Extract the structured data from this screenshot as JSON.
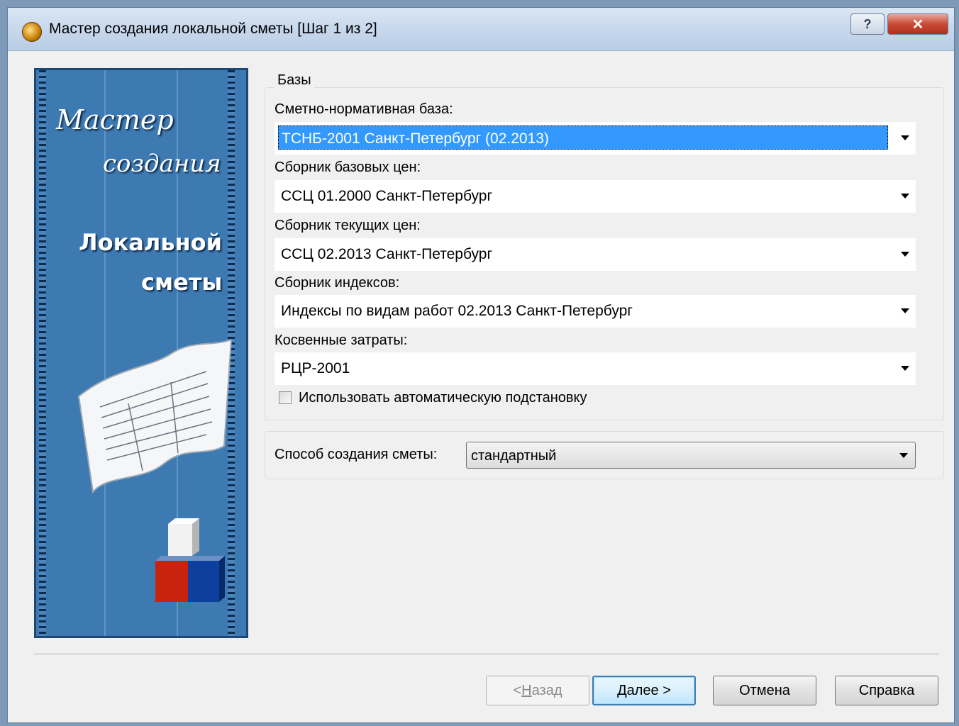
{
  "window": {
    "title": "Мастер создания локальной сметы [Шаг 1 из 2]",
    "help_label": "?",
    "close_label": "✕"
  },
  "banner": {
    "line1": "Мастер",
    "line2": "создания",
    "line3": "Локальной",
    "line4": "сметы"
  },
  "bases": {
    "legend": "Базы",
    "normative_label": "Сметно-нормативная база:",
    "normative_value": "ТСНБ-2001 Санкт-Петербург (02.2013)",
    "base_prices_label": "Сборник базовых цен:",
    "base_prices_value": "ССЦ 01.2000 Санкт-Петербург",
    "current_prices_label": "Сборник текущих цен:",
    "current_prices_value": "ССЦ 02.2013 Санкт-Петербург",
    "indexes_label": "Сборник индексов:",
    "indexes_value": "Индексы по видам работ 02.2013 Санкт-Петербург",
    "indirect_label": "Косвенные затраты:",
    "indirect_value": "РЦР-2001",
    "auto_checkbox_label": "Использовать автоматическую подстановку",
    "auto_checked": false
  },
  "method": {
    "label": "Способ создания сметы:",
    "value": "стандартный"
  },
  "buttons": {
    "back_prefix": "< ",
    "back_accel": "Н",
    "back_rest": "азад",
    "next_accel": "Д",
    "next_rest": "алее >",
    "cancel": "Отмена",
    "help": "Справка"
  },
  "colors": {
    "banner_bg": "#3e7ab2",
    "selection": "#3399ff",
    "red_cube": "#c8230c",
    "blue_cube": "#0d3f9e"
  }
}
